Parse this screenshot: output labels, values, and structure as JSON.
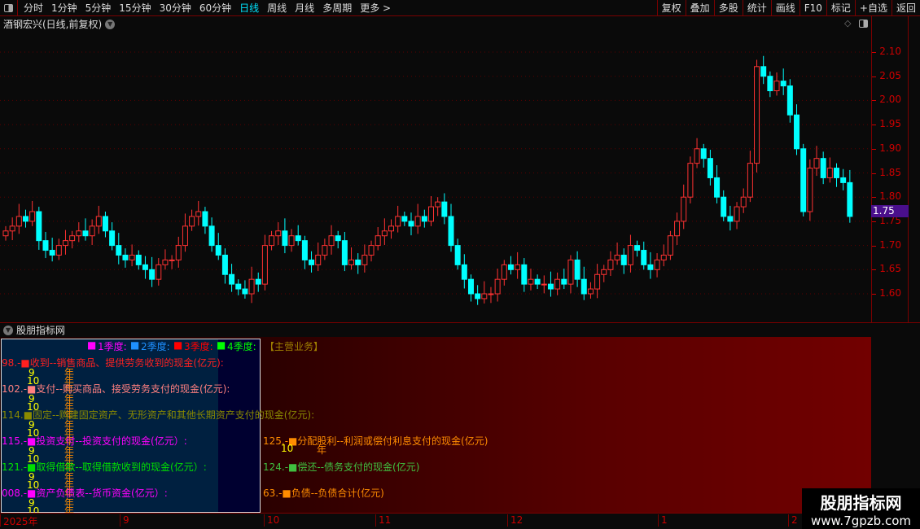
{
  "toolbar": {
    "periods": [
      "分时",
      "1分钟",
      "5分钟",
      "15分钟",
      "30分钟",
      "60分钟",
      "日线",
      "周线",
      "月线",
      "多周期",
      "更多 >"
    ],
    "active": "日线",
    "right_buttons": [
      "复权",
      "叠加",
      "多股",
      "统计",
      "画线",
      "F10",
      "标记",
      "+自选",
      "返回"
    ]
  },
  "stock_title": "酒钢宏兴(日线,前复权)",
  "price_axis": {
    "ticks": [
      "2.10",
      "2.05",
      "2.00",
      "1.95",
      "1.90",
      "1.85",
      "1.80",
      "1.75",
      "1.70",
      "1.65",
      "1.60"
    ],
    "current": "1.75",
    "current_bg": "#4a0f8c"
  },
  "colors": {
    "up": "#ff3232",
    "down": "#00ffff",
    "axis": "#cc0000"
  },
  "chart_data": {
    "type": "candlestick",
    "ylim": [
      1.57,
      2.14
    ],
    "closes": [
      1.73,
      1.74,
      1.76,
      1.75,
      1.77,
      1.71,
      1.69,
      1.68,
      1.7,
      1.71,
      1.72,
      1.73,
      1.72,
      1.74,
      1.76,
      1.73,
      1.7,
      1.68,
      1.67,
      1.68,
      1.66,
      1.65,
      1.63,
      1.66,
      1.67,
      1.67,
      1.7,
      1.74,
      1.76,
      1.77,
      1.74,
      1.7,
      1.68,
      1.64,
      1.62,
      1.61,
      1.6,
      1.63,
      1.62,
      1.7,
      1.72,
      1.73,
      1.7,
      1.72,
      1.71,
      1.67,
      1.66,
      1.68,
      1.7,
      1.72,
      1.71,
      1.66,
      1.67,
      1.66,
      1.68,
      1.7,
      1.72,
      1.73,
      1.74,
      1.76,
      1.75,
      1.74,
      1.76,
      1.75,
      1.78,
      1.79,
      1.76,
      1.7,
      1.66,
      1.63,
      1.6,
      1.59,
      1.6,
      1.6,
      1.63,
      1.66,
      1.65,
      1.66,
      1.62,
      1.63,
      1.62,
      1.62,
      1.61,
      1.63,
      1.62,
      1.67,
      1.63,
      1.6,
      1.61,
      1.64,
      1.65,
      1.67,
      1.68,
      1.66,
      1.7,
      1.69,
      1.66,
      1.65,
      1.67,
      1.68,
      1.72,
      1.75,
      1.8,
      1.87,
      1.9,
      1.88,
      1.84,
      1.8,
      1.76,
      1.75,
      1.78,
      1.8,
      1.87,
      2.07,
      2.05,
      2.02,
      2.04,
      2.03,
      1.97,
      1.9,
      1.77,
      1.86,
      1.88,
      1.84,
      1.86,
      1.84,
      1.83,
      1.76
    ]
  },
  "indicator": {
    "name": "股朋指标网",
    "legend": [
      {
        "label": "1季度:",
        "color": "#ff00ff"
      },
      {
        "label": "2季度:",
        "color": "#1e90ff"
      },
      {
        "label": "3季度:",
        "color": "#ff0000"
      },
      {
        "label": "4季度:",
        "color": "#00ff00"
      }
    ],
    "main_business": "【主营业务】",
    "left_items": [
      {
        "text": "98.-■收到--销售商品、提供劳务收到的现金(亿元):",
        "color": "#ff2020"
      },
      {
        "text": "102.-■支付--购买商品、接受劳务支付的现金(亿元):",
        "color": "#ff8080"
      },
      {
        "text": "114.■固定--购建固定资产、无形资产和其他长期资产支付的现金(亿元):",
        "color": "#8a8a00"
      },
      {
        "text": "115.-■投资支付--投资支付的现金(亿元）:",
        "color": "#ff00ff"
      },
      {
        "text": "121.-■取得借款--取得借款收到的现金(亿元）:",
        "color": "#00e000"
      },
      {
        "text": "008.-■资产负债表--货币资金(亿元）:",
        "color": "#ff00ff"
      }
    ],
    "right_items": [
      {
        "text": "125.-■分配股利--利润或偿付利息支付的现金(亿元)",
        "color": "#ff8c00"
      },
      {
        "text": "124.-■偿还--债务支付的现金(亿元)",
        "color": "#40c040"
      },
      {
        "text": "63.-■负债--负债合计(亿元)",
        "color": "#ff8c00"
      }
    ],
    "month_labels": [
      "9",
      "10"
    ],
    "year_char": "年"
  },
  "date_axis": [
    "2025年",
    "9",
    "10",
    "11",
    "12",
    "1",
    "2"
  ],
  "watermark": {
    "name": "股朋指标网",
    "url": "www.7gpzb.com"
  }
}
